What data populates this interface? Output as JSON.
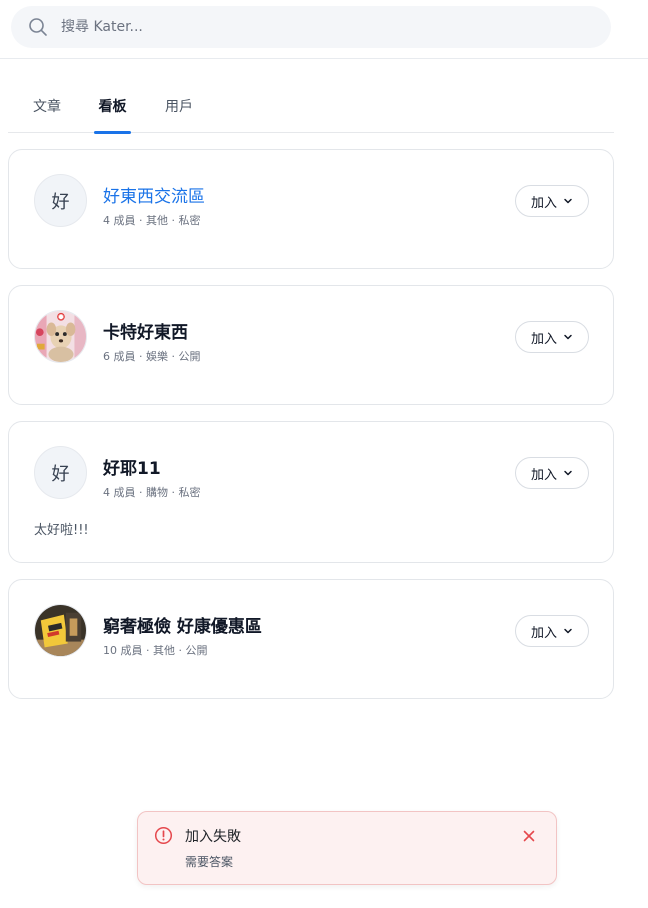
{
  "search": {
    "placeholder": "搜尋 Kater..."
  },
  "tabs": [
    {
      "label": "文章",
      "active": false
    },
    {
      "label": "看板",
      "active": true
    },
    {
      "label": "用戶",
      "active": false
    }
  ],
  "boards": [
    {
      "avatar_text": "好",
      "avatar_type": "text",
      "name": "好東西交流區",
      "name_link": true,
      "meta": "4 成員 · 其他 · 私密",
      "description": "",
      "join_label": "加入"
    },
    {
      "avatar_text": "",
      "avatar_type": "image-dog",
      "name": "卡特好東西",
      "name_link": false,
      "meta": "6 成員 · 娛樂 · 公開",
      "description": "",
      "join_label": "加入"
    },
    {
      "avatar_text": "好",
      "avatar_type": "text",
      "name": "好耶11",
      "name_link": false,
      "meta": "4 成員 · 購物 · 私密",
      "description": "太好啦!!!",
      "join_label": "加入"
    },
    {
      "avatar_text": "",
      "avatar_type": "image-product",
      "name": "窮奢極儉 好康優惠區",
      "name_link": false,
      "meta": "10 成員 · 其他 · 公開",
      "description": "",
      "join_label": "加入"
    }
  ],
  "toast": {
    "title": "加入失敗",
    "message": "需要答案"
  },
  "colors": {
    "accent": "#1a73e8",
    "error": "#e5484d",
    "toast_bg": "#fdf1f1"
  },
  "icons": {
    "search": "search-icon",
    "chevron": "chevron-down-icon",
    "alert": "alert-circle-icon",
    "close": "close-icon"
  }
}
